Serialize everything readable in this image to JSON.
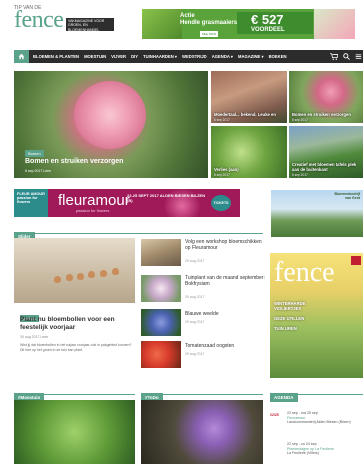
{
  "header": {
    "small_label": "TIP VAN DE",
    "logo": "fence",
    "tagline": "VAKMAGAZINE VOOR GROEN- EN BLOEMENHANDEL"
  },
  "top_ad": {
    "text": "Actie\nHendle grasmaaiers",
    "price": "€ 527",
    "price_sub": "VOORDEEL",
    "tag": "SEE NOW"
  },
  "nav": {
    "items": [
      "BLOEMEN & PLANTEN",
      "MOESTUIN",
      "VIJVER",
      "DIY",
      "TUINHAARDEN ▾",
      "WEDSTRIJD",
      "AGENDA ▾",
      "MAGAZINE ▾",
      "BOEKEN"
    ]
  },
  "featured": {
    "main": {
      "badge": "Bomen",
      "title": "Bomen en struiken verzorgen",
      "meta": "6 sep 2017   Leen"
    },
    "small": [
      {
        "caption": "Moedertaal... bekend. Leuke en",
        "meta": "6 sep 2017"
      },
      {
        "caption": "Bomen en struiken verzorgen",
        "meta": "6 sep 2017"
      },
      {
        "caption": "Verlies (aan)",
        "meta": "6 sep 2017"
      },
      {
        "caption": "Creatief met bloemen tafels plek aan de buitenkant",
        "meta": "6 sep 2017"
      }
    ]
  },
  "banner": {
    "logo_text": "FLEUR AMOUR\npassion for flowers",
    "brand": "fleuramour",
    "sub": "passion for flowers",
    "event": "22-25 SEPT 2017 ALDEN BIESEN BILZEN (B)",
    "tickets": "TICKETS"
  },
  "side_ad": {
    "text": "Bloemenbedrijf\nvan Gent"
  },
  "sections": {
    "slider": "Slider",
    "moestuin": "#Moestuin",
    "todo": "#ToDo",
    "agenda": "AGENDA"
  },
  "slider_post": {
    "badge": "Bomen",
    "title": "Plant nu bloembollen voor een feestelijk voorjaar",
    "meta": "30 aug 2017   Leen",
    "excerpt": "Wist jij dat bloembollen in het najaar voorjaar ook in pakgebied kunnen? Dit hier op het groen in de tuin kan plant."
  },
  "slider_list": [
    {
      "title": "Volg een workshop bloemschikken op Fleuramour",
      "meta": "29 aug 2017"
    },
    {
      "title": "Tuinplant van de maand september: Bokfrysiam",
      "meta": "29 aug 2017"
    },
    {
      "title": "Blauwe weelde",
      "meta": "29 aug 2017"
    },
    {
      "title": "Tomatenzaad oogsten",
      "meta": "29 aug 2017"
    }
  ],
  "magazine": {
    "name": "fence",
    "lines": "WINTERHARDE VIOLIERTJES\n\nGEZE UTILLEN\n\nTUIN UREN"
  },
  "agenda": [
    {
      "date": "22/25",
      "range": "22 sep - ma 25 sep",
      "name": "Fleuramour",
      "place": "Landcommanderij Alden Biesen (Bilzen)"
    },
    {
      "date": "",
      "range": "22 sep - zo 24 sep",
      "name": "Plantendagen op La Feullerie",
      "place": "La Feullerie (Villers)"
    }
  ],
  "colors": {
    "accent": "#5aa38a",
    "nav": "#2c2c2c",
    "banner": "#a01a5a"
  }
}
